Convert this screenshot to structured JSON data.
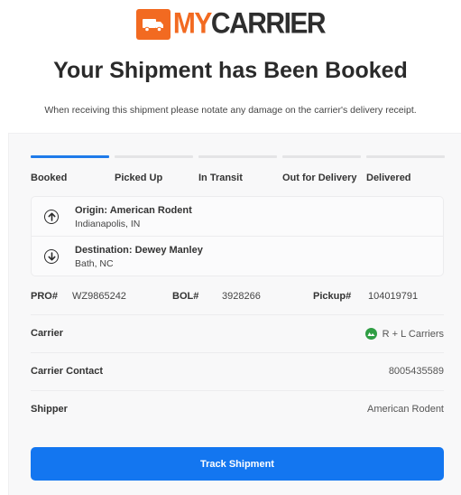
{
  "brand": {
    "logo_my": "MY",
    "logo_carrier": "CARRIER",
    "accent_color": "#f26a21",
    "icon": "truck-icon"
  },
  "headline": "Your Shipment has Been Booked",
  "subline": "When receiving this shipment please notate any damage on the carrier's delivery receipt.",
  "progress": {
    "active_step": 0,
    "steps": [
      {
        "label": "Booked",
        "active": true
      },
      {
        "label": "Picked Up",
        "active": false
      },
      {
        "label": "In Transit",
        "active": false
      },
      {
        "label": "Out for Delivery",
        "active": false
      },
      {
        "label": "Delivered",
        "active": false
      }
    ]
  },
  "route": {
    "origin": {
      "title": "Origin: American Rodent",
      "location": "Indianapolis, IN",
      "icon": "arrow-up-circle-icon"
    },
    "destination": {
      "title": "Destination: Dewey Manley",
      "location": "Bath, NC",
      "icon": "arrow-down-circle-icon"
    }
  },
  "references": {
    "pro_label": "PRO#",
    "pro_value": "WZ9865242",
    "bol_label": "BOL#",
    "bol_value": "3928266",
    "pickup_label": "Pickup#",
    "pickup_value": "104019791"
  },
  "details": {
    "carrier_label": "Carrier",
    "carrier_value": "R + L Carriers",
    "carrier_icon": "carrier-logo-icon",
    "contact_label": "Carrier Contact",
    "contact_value": "8005435589",
    "shipper_label": "Shipper",
    "shipper_value": "American Rodent"
  },
  "actions": {
    "track_label": "Track Shipment",
    "button_color": "#1376f0"
  }
}
